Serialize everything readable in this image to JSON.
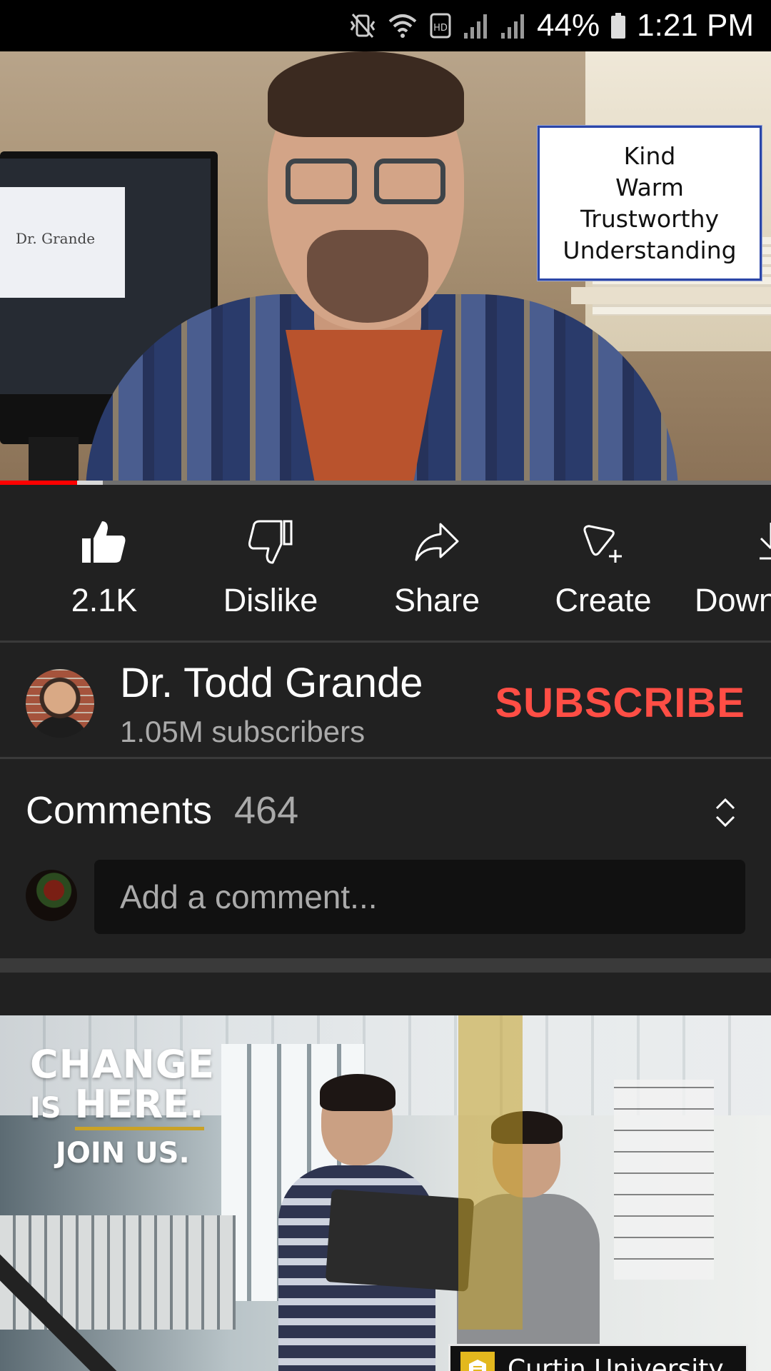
{
  "status_bar": {
    "icons": [
      "mute-vibrate-icon",
      "wifi-icon",
      "data-saver-icon",
      "signal-icon",
      "signal-icon"
    ],
    "battery_percent": "44%",
    "time": "1:21 PM"
  },
  "video": {
    "overlay_card": [
      "Kind",
      "Warm",
      "Trustworthy",
      "Understanding"
    ],
    "monitor_text": "Dr. Grande",
    "progress_fraction": 0.1,
    "buffered_fraction": 0.133,
    "colors": {
      "played": "#ff0000",
      "buffered": "#d8d8d8",
      "track": "#6f6f6f"
    }
  },
  "actions": [
    {
      "icon": "thumbs-up-filled-icon",
      "label": "2.1K"
    },
    {
      "icon": "thumbs-down-icon",
      "label": "Dislike"
    },
    {
      "icon": "share-arrow-icon",
      "label": "Share"
    },
    {
      "icon": "create-remix-icon",
      "label": "Create"
    },
    {
      "icon": "download-icon",
      "label": "Down"
    }
  ],
  "channel": {
    "name": "Dr. Todd Grande",
    "subscribers": "1.05M subscribers",
    "subscribe_label": "SUBSCRIBE",
    "accent": "#ff4e45"
  },
  "comments": {
    "title": "Comments",
    "count": "464",
    "placeholder": "Add a comment..."
  },
  "ad": {
    "tagline_1": "CHANGE",
    "tagline_2_prefix": "IS",
    "tagline_2_word": "HERE.",
    "tagline_3": "JOIN US.",
    "brand": "Curtin University"
  }
}
